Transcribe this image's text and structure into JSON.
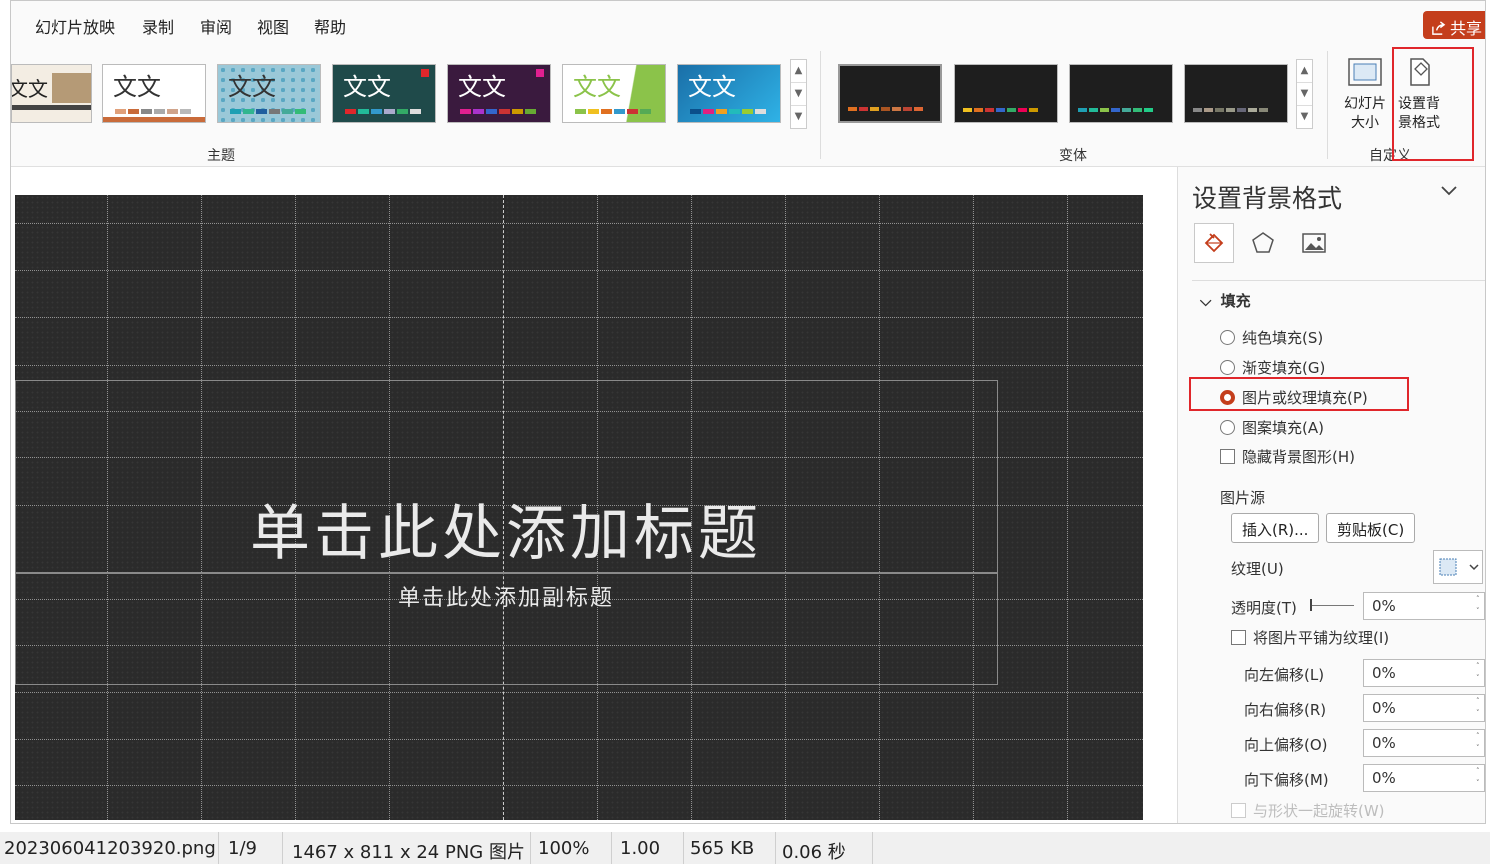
{
  "menu": [
    "幻灯片放映",
    "录制",
    "审阅",
    "视图",
    "帮助"
  ],
  "share_label": "共享",
  "ribbon": {
    "themes_label": "主题",
    "variants_label": "变体",
    "customize_label": "自定义",
    "theme_glyph": "文文",
    "slide_size_label": "幻灯片大小",
    "format_bg_label": "设置背景格式"
  },
  "slide": {
    "title": "单击此处添加标题",
    "subtitle": "单击此处添加副标题"
  },
  "pane": {
    "title": "设置背景格式",
    "section_fill": "填充",
    "options": {
      "solid": "纯色填充(S)",
      "gradient": "渐变填充(G)",
      "picture": "图片或纹理填充(P)",
      "pattern": "图案填充(A)",
      "hide_bg": "隐藏背景图形(H)"
    },
    "picture_source": "图片源",
    "insert_btn": "插入(R)...",
    "clipboard_btn": "剪贴板(C)",
    "texture": "纹理(U)",
    "transparency": "透明度(T)",
    "transparency_value": "0%",
    "tile": "将图片平铺为纹理(I)",
    "offset_left": "向左偏移(L)",
    "offset_left_value": "0%",
    "offset_right": "向右偏移(R)",
    "offset_right_value": "0%",
    "offset_up": "向上偏移(O)",
    "offset_up_value": "0%",
    "offset_down": "向下偏移(M)",
    "offset_down_value": "0%",
    "rotate_with_shape": "与形状一起旋转(W)"
  },
  "status": {
    "filename": "202306041203920.png",
    "index": "1/9",
    "dims": "1467 x 811 x 24 PNG 图片",
    "zoom": "100%",
    "ratio": "1.00",
    "size": "565 KB",
    "time": "0.06 秒"
  },
  "colors": {
    "accent": "#c43e1c",
    "highlight": "#e0262b",
    "slide_bg": "#2b2b2b"
  }
}
